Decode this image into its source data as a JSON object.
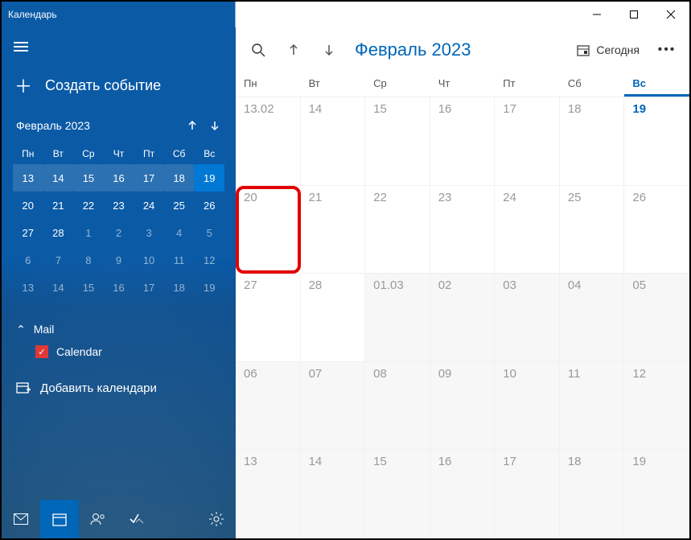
{
  "window": {
    "title": "Календарь"
  },
  "sidebar": {
    "create_label": "Создать событие",
    "mini_month": "Февраль 2023",
    "dow": [
      "Пн",
      "Вт",
      "Ср",
      "Чт",
      "Пт",
      "Сб",
      "Вс"
    ],
    "mini_weeks": [
      [
        {
          "n": "13",
          "w": true
        },
        {
          "n": "14",
          "w": true
        },
        {
          "n": "15",
          "w": true
        },
        {
          "n": "16",
          "w": true
        },
        {
          "n": "17",
          "w": true
        },
        {
          "n": "18",
          "w": true
        },
        {
          "n": "19",
          "w": true,
          "t": true
        }
      ],
      [
        {
          "n": "20"
        },
        {
          "n": "21"
        },
        {
          "n": "22"
        },
        {
          "n": "23"
        },
        {
          "n": "24"
        },
        {
          "n": "25"
        },
        {
          "n": "26"
        }
      ],
      [
        {
          "n": "27"
        },
        {
          "n": "28"
        },
        {
          "n": "1",
          "d": true
        },
        {
          "n": "2",
          "d": true
        },
        {
          "n": "3",
          "d": true
        },
        {
          "n": "4",
          "d": true
        },
        {
          "n": "5",
          "d": true
        }
      ],
      [
        {
          "n": "6",
          "d": true
        },
        {
          "n": "7",
          "d": true
        },
        {
          "n": "8",
          "d": true
        },
        {
          "n": "9",
          "d": true
        },
        {
          "n": "10",
          "d": true
        },
        {
          "n": "11",
          "d": true
        },
        {
          "n": "12",
          "d": true
        }
      ],
      [
        {
          "n": "13",
          "d": true
        },
        {
          "n": "14",
          "d": true
        },
        {
          "n": "15",
          "d": true
        },
        {
          "n": "16",
          "d": true
        },
        {
          "n": "17",
          "d": true
        },
        {
          "n": "18",
          "d": true
        },
        {
          "n": "19",
          "d": true
        }
      ]
    ],
    "account_label": "Mail",
    "calendar_label": "Calendar",
    "add_label": "Добавить календари"
  },
  "main": {
    "month_label": "Февраль 2023",
    "today_label": "Сегодня",
    "dow": [
      "Пн",
      "Вт",
      "Ср",
      "Чт",
      "Пт",
      "Сб",
      "Вс"
    ],
    "today_col": 6,
    "weeks": [
      [
        {
          "n": "13.02"
        },
        {
          "n": "14"
        },
        {
          "n": "15"
        },
        {
          "n": "16"
        },
        {
          "n": "17"
        },
        {
          "n": "18"
        },
        {
          "n": "19",
          "today": true
        }
      ],
      [
        {
          "n": "20",
          "hl": true
        },
        {
          "n": "21"
        },
        {
          "n": "22"
        },
        {
          "n": "23"
        },
        {
          "n": "24"
        },
        {
          "n": "25"
        },
        {
          "n": "26"
        }
      ],
      [
        {
          "n": "27"
        },
        {
          "n": "28"
        },
        {
          "n": "01.03",
          "dim": true
        },
        {
          "n": "02",
          "dim": true
        },
        {
          "n": "03",
          "dim": true
        },
        {
          "n": "04",
          "dim": true
        },
        {
          "n": "05",
          "dim": true
        }
      ],
      [
        {
          "n": "06",
          "dim": true
        },
        {
          "n": "07",
          "dim": true
        },
        {
          "n": "08",
          "dim": true
        },
        {
          "n": "09",
          "dim": true
        },
        {
          "n": "10",
          "dim": true
        },
        {
          "n": "11",
          "dim": true
        },
        {
          "n": "12",
          "dim": true
        }
      ],
      [
        {
          "n": "13",
          "dim": true
        },
        {
          "n": "14",
          "dim": true
        },
        {
          "n": "15",
          "dim": true
        },
        {
          "n": "16",
          "dim": true
        },
        {
          "n": "17",
          "dim": true
        },
        {
          "n": "18",
          "dim": true
        },
        {
          "n": "19",
          "dim": true
        }
      ]
    ]
  }
}
